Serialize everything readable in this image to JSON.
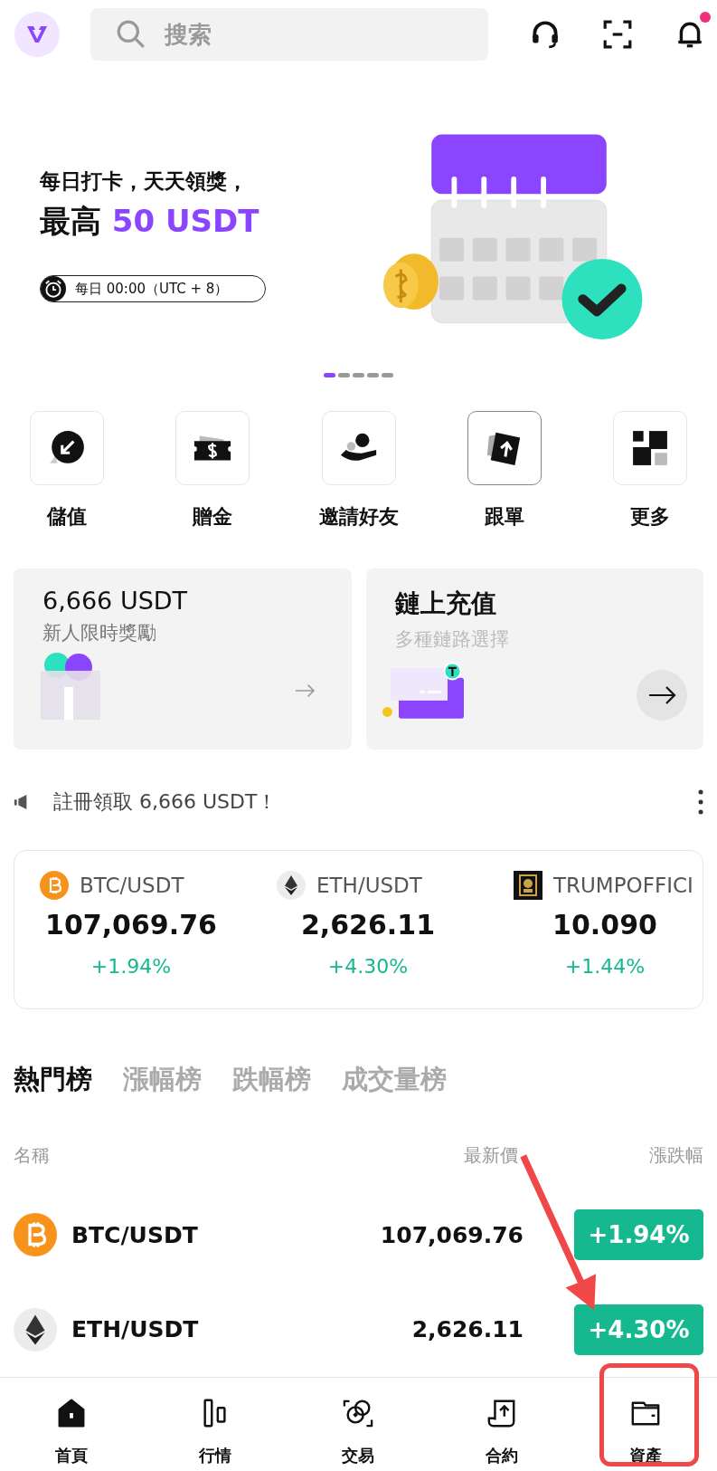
{
  "header": {
    "search": {
      "placeholder": "搜索"
    },
    "has_unread": true
  },
  "banner": {
    "line1": "每日打卡，天天領獎，",
    "line2_prefix": "最高",
    "line2_highlight": "50 USDT",
    "schedule": "每日 00:00（UTC + 8）",
    "slides": [
      {
        "selected": true
      },
      {
        "selected": false
      },
      {
        "selected": false
      },
      {
        "selected": false
      },
      {
        "selected": false
      }
    ]
  },
  "shortcuts": [
    {
      "kind": "deposit",
      "label": "儲值",
      "highlighted": false
    },
    {
      "kind": "bonus",
      "label": "贈金",
      "highlighted": false
    },
    {
      "kind": "invite",
      "label": "邀請好友",
      "highlighted": false
    },
    {
      "kind": "copy",
      "label": "跟單",
      "highlighted": true
    },
    {
      "kind": "more",
      "label": "更多",
      "highlighted": false
    }
  ],
  "promo_cards": [
    {
      "kind": "gift",
      "title": "6,666 USDT",
      "subtitle": "新人限時獎勵"
    },
    {
      "kind": "chain",
      "title": "鏈上充值",
      "subtitle": "多種鏈路選擇"
    }
  ],
  "notice": "註冊領取 6,666 USDT！",
  "ticker": [
    {
      "kind": "btc",
      "pair": "BTC/USDT",
      "price": "107,069.76",
      "change": "+1.94%"
    },
    {
      "kind": "eth",
      "pair": "ETH/USDT",
      "price": "2,626.11",
      "change": "+4.30%"
    },
    {
      "kind": "trump",
      "pair": "TRUMPOFFICI",
      "price": "10.090",
      "change": "+1.44%"
    }
  ],
  "rank_tabs": [
    {
      "label": "熱門榜",
      "selected": true
    },
    {
      "label": "漲幅榜",
      "selected": false
    },
    {
      "label": "跌幅榜",
      "selected": false
    },
    {
      "label": "成交量榜",
      "selected": false
    }
  ],
  "table": {
    "columns": [
      "名稱",
      "最新價",
      "漲跌幅"
    ],
    "rows": [
      {
        "kind": "btc",
        "pair": "BTC/USDT",
        "price": "107,069.76",
        "change": "+1.94%"
      },
      {
        "kind": "eth",
        "pair": "ETH/USDT",
        "price": "2,626.11",
        "change": "+4.30%"
      }
    ]
  },
  "nav": [
    {
      "kind": "home",
      "label": "首頁",
      "selected": true
    },
    {
      "kind": "market",
      "label": "行情",
      "selected": false
    },
    {
      "kind": "trade",
      "label": "交易",
      "selected": false
    },
    {
      "kind": "futures",
      "label": "合約",
      "selected": false
    },
    {
      "kind": "assets",
      "label": "資產",
      "selected": false
    }
  ]
}
